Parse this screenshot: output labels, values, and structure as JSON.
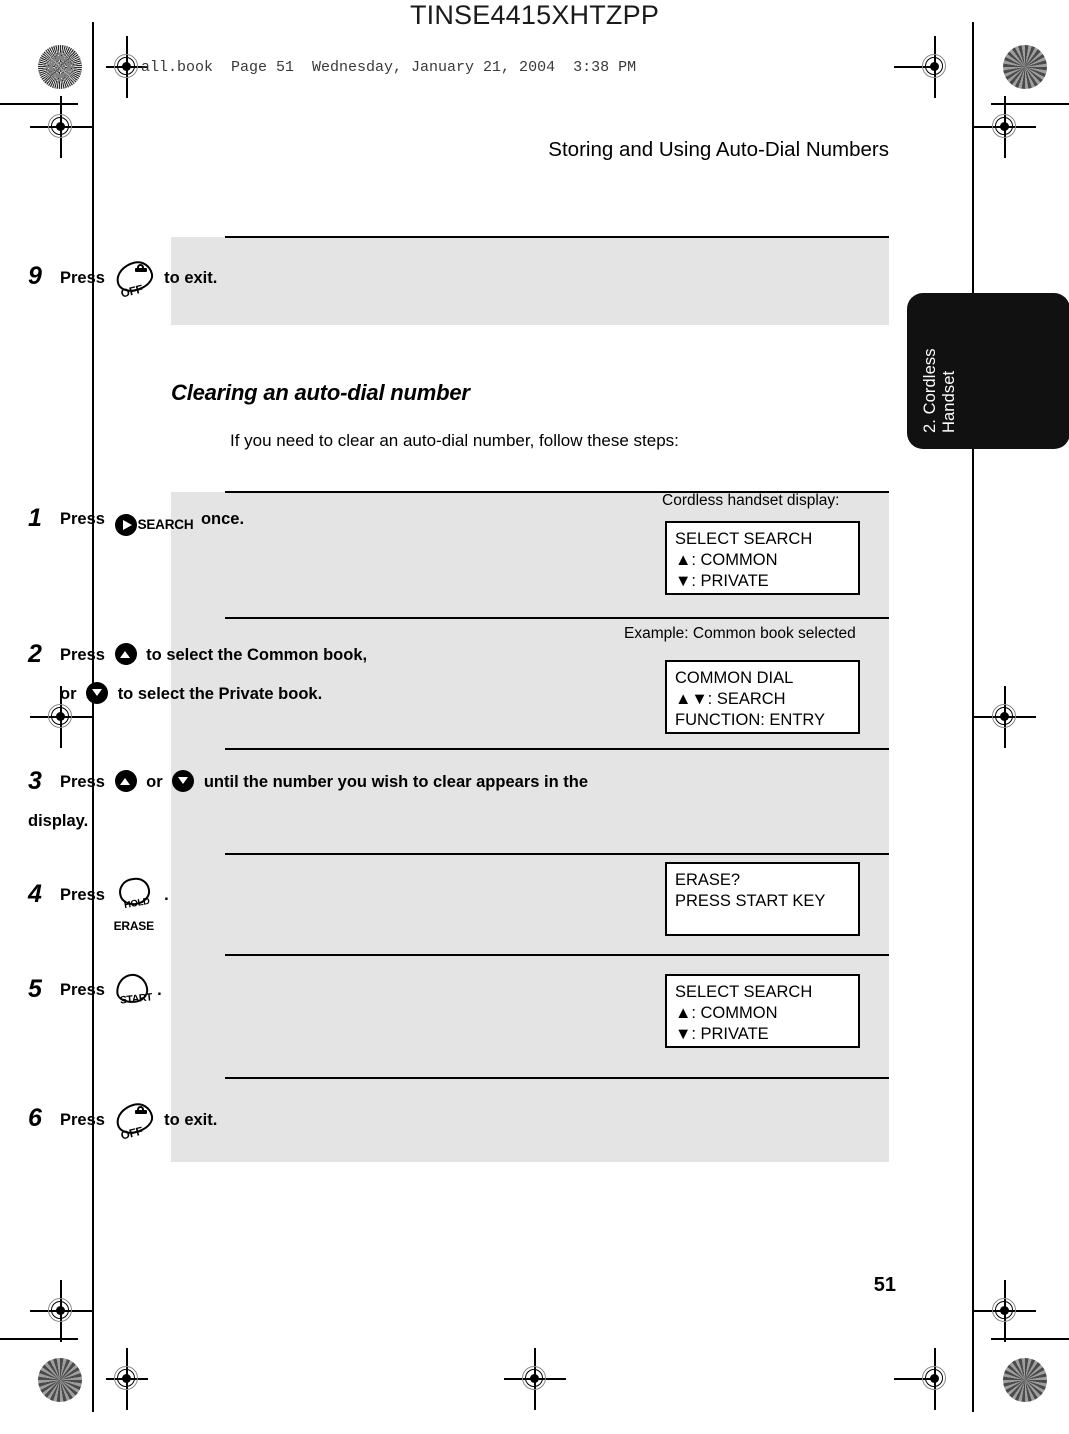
{
  "document": {
    "code": "TINSE4415XHTZPP",
    "file_line": "all.book  Page 51  Wednesday, January 21, 2004  3:38 PM",
    "running_head": "Storing and Using Auto-Dial Numbers",
    "page_number": "51"
  },
  "side_tab": {
    "line1": "2. Cordless",
    "line2": "Handset"
  },
  "top_step": {
    "number": "9",
    "press_label": "Press",
    "key": "off-key",
    "key_label": "OFF",
    "tail": "to exit."
  },
  "section": {
    "title": "Clearing an auto-dial number",
    "intro": "If you need to clear an auto-dial number, follow these steps:"
  },
  "steps": [
    {
      "number": "1",
      "line1_a": "Press",
      "key": "search-key",
      "key_label": "SEARCH",
      "line1_b": "once.",
      "caption": "Cordless handset display:",
      "display": "SELECT SEARCH\n▲: COMMON\n▼: PRIVATE"
    },
    {
      "number": "2",
      "line1_a": "Press",
      "key1": "up-arrow-key",
      "line1_b": "to select the Common book,",
      "line2_a": "or",
      "key2": "down-arrow-key",
      "line2_b": "to select the Private book.",
      "caption": "Example: Common book selected",
      "display": "COMMON DIAL\n▲▼: SEARCH\nFUNCTION: ENTRY"
    },
    {
      "number": "3",
      "line1_a": "Press",
      "key1": "up-arrow-key",
      "line1_b": "or",
      "key2": "down-arrow-key",
      "line1_c": "until the number you wish to clear appears in the",
      "line2": "display.",
      "caption": "",
      "display": ""
    },
    {
      "number": "4",
      "line1_a": "Press",
      "key": "hold-erase-key",
      "key_label_top": "HOLD",
      "key_label_bottom": "ERASE",
      "line1_b": ".",
      "caption": "",
      "display": "ERASE?\nPRESS START KEY"
    },
    {
      "number": "5",
      "line1_a": "Press",
      "key": "start-key",
      "key_label": "START",
      "line1_b": ".",
      "caption": "",
      "display": "SELECT SEARCH\n▲: COMMON\n▼: PRIVATE"
    },
    {
      "number": "6",
      "line1_a": "Press",
      "key": "off-key",
      "key_label": "OFF",
      "line1_b": "to exit.",
      "caption": "",
      "display": ""
    }
  ],
  "colors": {
    "panel_gray": "#e4e4e4",
    "tab_black": "#111111",
    "text": "#000000"
  }
}
